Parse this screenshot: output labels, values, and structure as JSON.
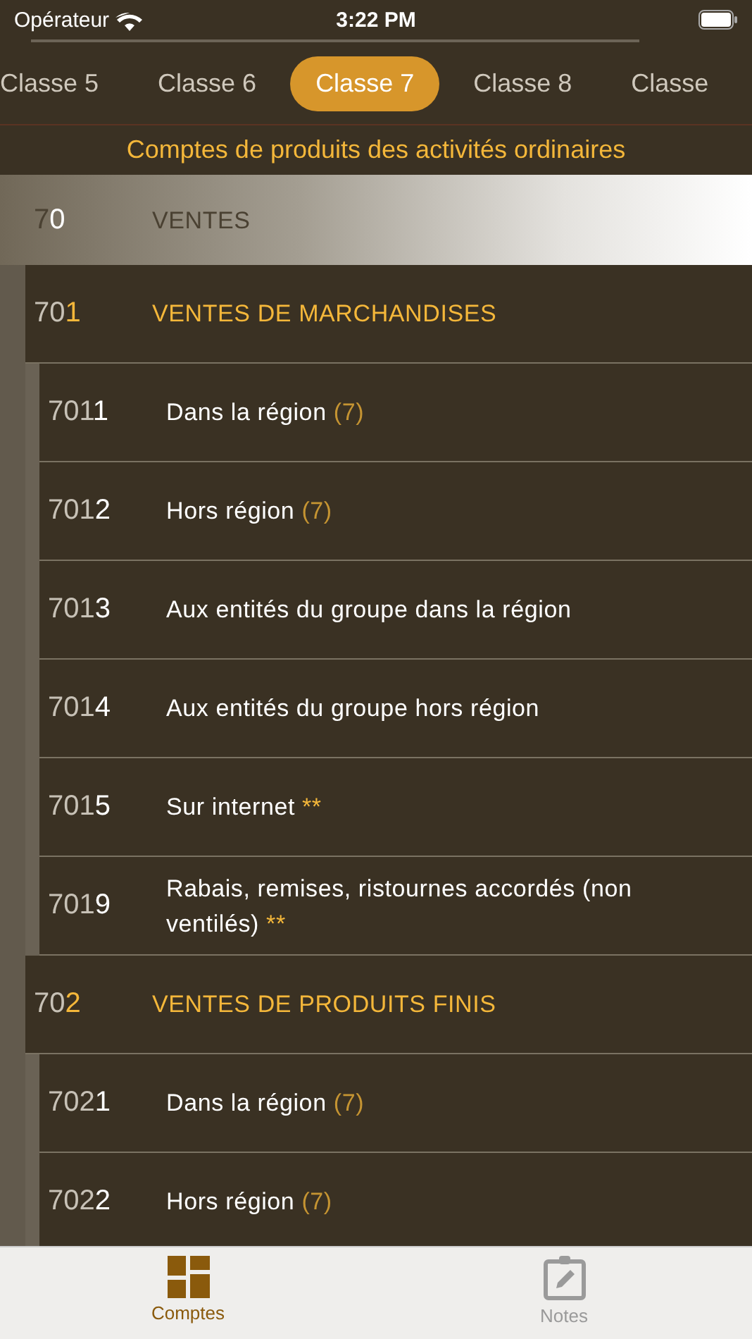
{
  "status_bar": {
    "carrier": "Opérateur",
    "time": "3:22 PM"
  },
  "tabs": [
    {
      "label": "Classe 5",
      "selected": false
    },
    {
      "label": "Classe 6",
      "selected": false
    },
    {
      "label": "Classe 7",
      "selected": true
    },
    {
      "label": "Classe 8",
      "selected": false
    },
    {
      "label": "Classe",
      "selected": false
    }
  ],
  "subtitle": "Comptes de produits des activités ordinaires",
  "accounts": [
    {
      "code": "70",
      "title": "VENTES",
      "children": [
        {
          "code": "701",
          "title": "VENTES DE MARCHANDISES",
          "children": [
            {
              "code": "7011",
              "title": "Dans la région",
              "note": "(7)"
            },
            {
              "code": "7012",
              "title": "Hors région",
              "note": "(7)"
            },
            {
              "code": "7013",
              "title": "Aux entités du groupe dans la région"
            },
            {
              "code": "7014",
              "title": "Aux entités du groupe hors région"
            },
            {
              "code": "7015",
              "title": "Sur internet",
              "note": "**"
            },
            {
              "code": "7019",
              "title": "Rabais, remises, ristournes accordés (non ventilés)",
              "note": "**"
            }
          ]
        },
        {
          "code": "702",
          "title": "VENTES DE PRODUITS FINIS",
          "children": [
            {
              "code": "7021",
              "title": "Dans la région",
              "note": "(7)"
            },
            {
              "code": "7022",
              "title": "Hors région",
              "note": "(7)"
            }
          ]
        }
      ]
    }
  ],
  "tab_bar": [
    {
      "label": "Comptes",
      "kind": "grid",
      "selected": true
    },
    {
      "label": "Notes",
      "kind": "clipboard",
      "selected": false
    }
  ]
}
